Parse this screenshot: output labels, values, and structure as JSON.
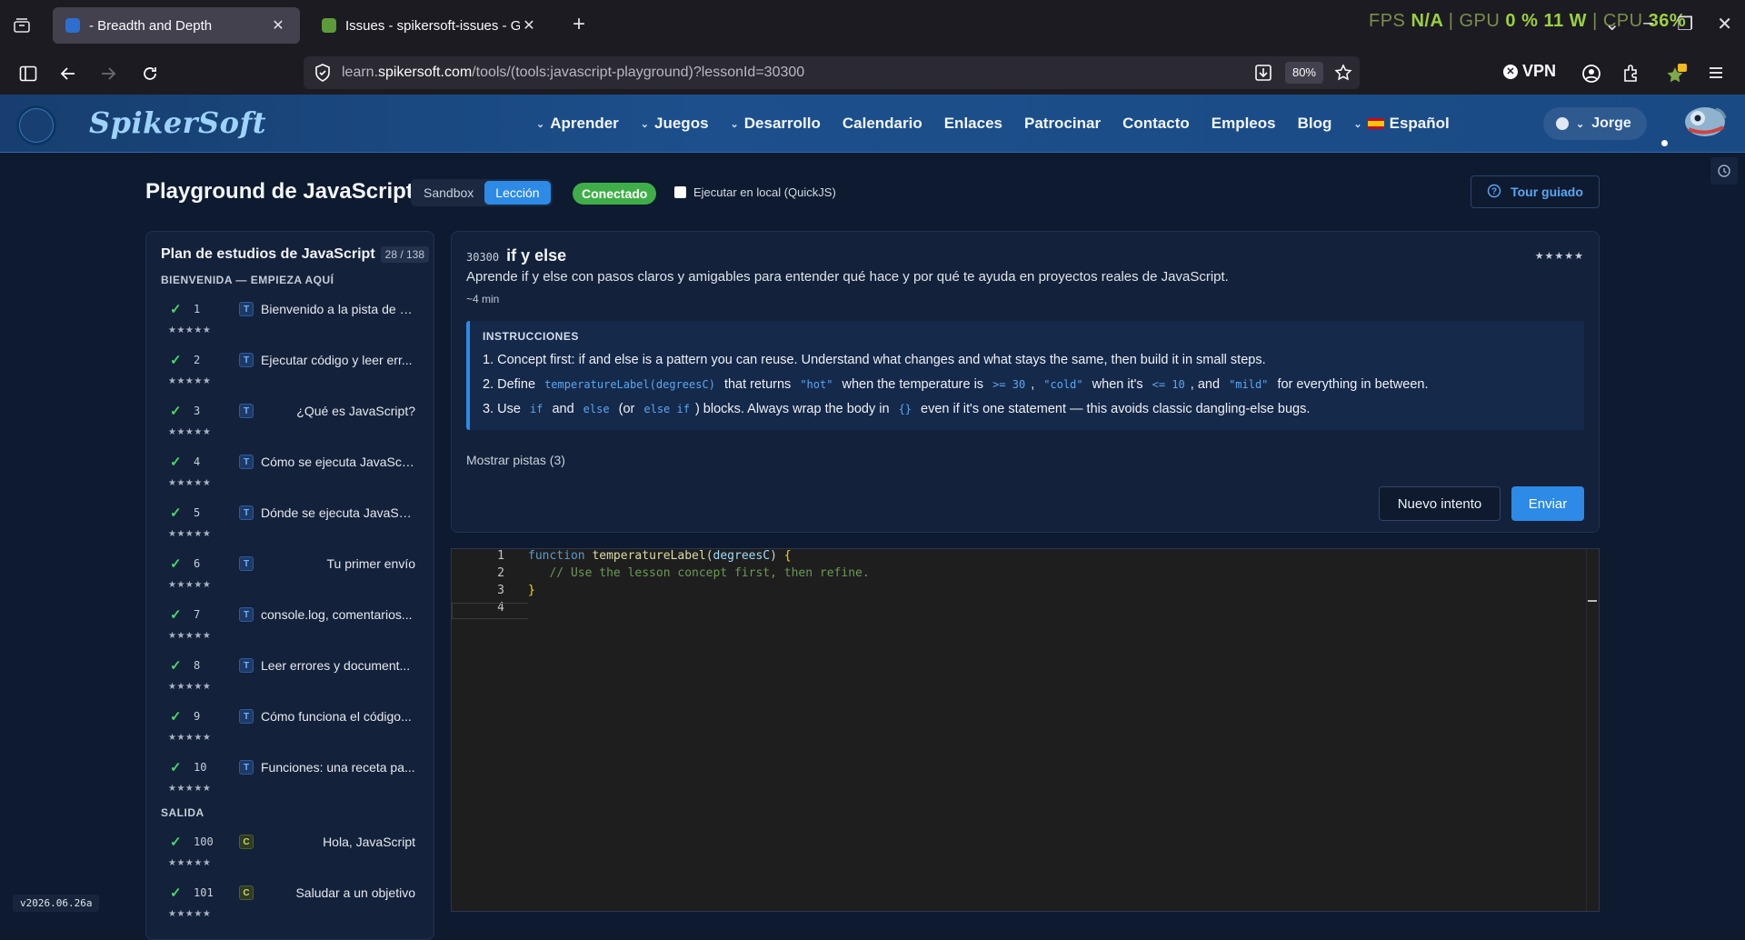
{
  "browser": {
    "tabs": [
      {
        "title": "- Breadth and Depth",
        "active": true
      },
      {
        "title": "Issues - spikersoft-issues - Gitea",
        "active": false
      }
    ],
    "perf_overlay": {
      "fps_label": "FPS",
      "fps_value": "N/A",
      "gpu_label": "GPU",
      "gpu_value": "0 %",
      "power": "11 W",
      "cpu_label": "CPU",
      "cpu_value": "36%"
    },
    "url": {
      "prefix": "learn.",
      "host": "spikersoft.com",
      "path": "/tools/(tools:javascript-playground)?lessonId=30300"
    },
    "zoom": "80%",
    "vpn_label": "VPN"
  },
  "site": {
    "logo": "SpikerSoft",
    "nav": [
      "Aprender",
      "Juegos",
      "Desarrollo",
      "Calendario",
      "Enlaces",
      "Patrocinar",
      "Contacto",
      "Empleos",
      "Blog"
    ],
    "language": "Español",
    "user": "Jorge"
  },
  "page": {
    "title": "Playground de JavaScript",
    "modes": [
      "Sandbox",
      "Lección"
    ],
    "active_mode": "Lección",
    "status": "Conectado",
    "local_run_label": "Ejecutar en local (QuickJS)",
    "tour_label": "Tour guiado"
  },
  "sidebar": {
    "title": "Plan de estudios de JavaScript",
    "count": "28 / 138",
    "sections": [
      {
        "title": "BIENVENIDA — EMPIEZA AQUÍ",
        "lessons": [
          {
            "num": "1",
            "type": "T",
            "title": "Bienvenido a la pista de J...",
            "stars": "★★★★★"
          },
          {
            "num": "2",
            "type": "T",
            "title": "Ejecutar código y leer err...",
            "stars": "★★★★★"
          },
          {
            "num": "3",
            "type": "T",
            "title": "¿Qué es JavaScript?",
            "stars": "★★★★★"
          },
          {
            "num": "4",
            "type": "T",
            "title": "Cómo se ejecuta JavaScr...",
            "stars": "★★★★★"
          },
          {
            "num": "5",
            "type": "T",
            "title": "Dónde se ejecuta JavaSc...",
            "stars": "★★★★★"
          },
          {
            "num": "6",
            "type": "T",
            "title": "Tu primer envío",
            "stars": "★★★★★"
          },
          {
            "num": "7",
            "type": "T",
            "title": "console.log, comentarios...",
            "stars": "★★★★★"
          },
          {
            "num": "8",
            "type": "T",
            "title": "Leer errores y document...",
            "stars": "★★★★★"
          },
          {
            "num": "9",
            "type": "T",
            "title": "Cómo funciona el código...",
            "stars": "★★★★★"
          },
          {
            "num": "10",
            "type": "T",
            "title": "Funciones: una receta pa...",
            "stars": "★★★★★"
          }
        ]
      },
      {
        "title": "SALIDA",
        "lessons": [
          {
            "num": "100",
            "type": "C",
            "title": "Hola, JavaScript",
            "stars": "★★★★★"
          },
          {
            "num": "101",
            "type": "C",
            "title": "Saludar a un objetivo",
            "stars": "★★★★★"
          }
        ]
      }
    ]
  },
  "lesson": {
    "id": "30300",
    "title": "if y else",
    "stars": "★★★★★",
    "description": "Aprende if y else con pasos claros y amigables para entender qué hace y por qué te ayuda en proyectos reales de JavaScript.",
    "time": "~4 min",
    "instructions_title": "INSTRUCCIONES",
    "step1": "1. Concept first: if and else is a pattern you can reuse. Understand what changes and what stays the same, then build it in small steps.",
    "step2": {
      "a": "2. Define",
      "code1": "temperatureLabel(degreesC)",
      "b": "that returns",
      "code2": "\"hot\"",
      "c": "when the temperature is",
      "code3": ">= 30",
      "d": ",",
      "code4": "\"cold\"",
      "e": "when it's",
      "code5": "<= 10",
      "f": ", and",
      "code6": "\"mild\"",
      "g": "for everything in between."
    },
    "step3": {
      "a": "3. Use",
      "code1": "if",
      "b": "and",
      "code2": "else",
      "c": "(or",
      "code3": "else if",
      "d": ") blocks. Always wrap the body in",
      "code4": "{}",
      "e": "even if it's one statement — this avoids classic dangling-else bugs."
    },
    "hints_label": "Mostrar pistas (3)",
    "retry_label": "Nuevo intento",
    "submit_label": "Enviar"
  },
  "editor": {
    "line_numbers": [
      "1",
      "2",
      "3",
      "4"
    ],
    "line1": {
      "kw": "function",
      "fn": "temperatureLabel",
      "open": "(",
      "param": "degreesC",
      "close": ")",
      "brace": "{"
    },
    "line2": "// Use the lesson concept first, then refine.",
    "line3": "}"
  },
  "version": "v2026.06.26a"
}
